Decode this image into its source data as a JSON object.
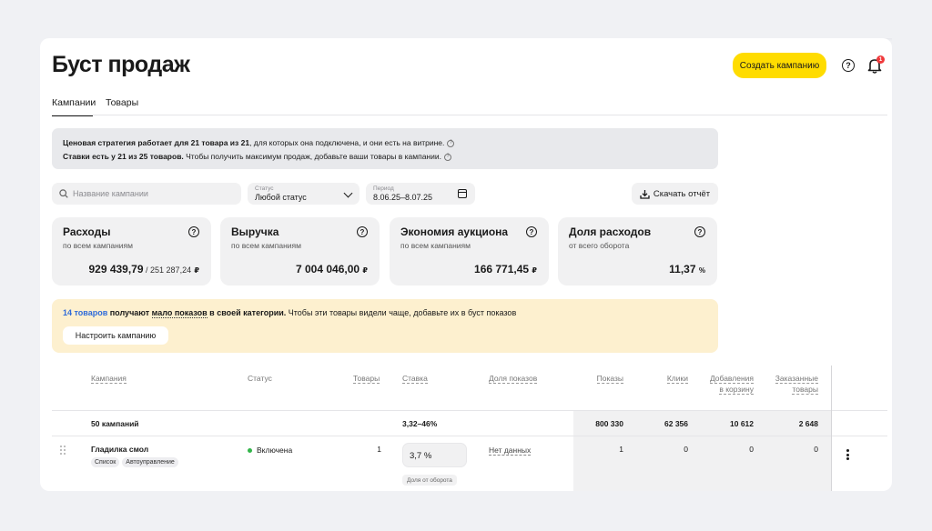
{
  "page": {
    "title": "Буст продаж",
    "create_button": "Создать кампанию",
    "notifications_count": "1"
  },
  "tabs": [
    {
      "label": "Кампании",
      "active": true
    },
    {
      "label": "Товары",
      "active": false
    }
  ],
  "info": {
    "line1_bold": "Ценовая стратегия работает для 21 товара из 21",
    "line1_rest": ", для которых она подключена, и они есть на витрине.",
    "line2_bold": "Ставки есть у 21 из 25 товаров.",
    "line2_rest": " Чтобы получить максимум продаж, добавьте ваши товары в кампании."
  },
  "filters": {
    "search_placeholder": "Название кампании",
    "status_label": "Статус",
    "status_value": "Любой статус",
    "period_label": "Период",
    "period_value": "8.06.25–8.07.25",
    "download_label": "Скачать отчёт"
  },
  "metrics": [
    {
      "title": "Расходы",
      "subtitle": "по всем кампаниям",
      "value": "929 439,79",
      "value_sub": " / 251 287,24",
      "currency": "₽"
    },
    {
      "title": "Выручка",
      "subtitle": "по всем кампаниям",
      "value": "7 004 046,00",
      "value_sub": "",
      "currency": "₽"
    },
    {
      "title": "Экономия аукциона",
      "subtitle": "по всем кампаниям",
      "value": "166 771,45",
      "value_sub": "",
      "currency": "₽"
    },
    {
      "title": "Доля расходов",
      "subtitle": "от всего оборота",
      "value": "11,37",
      "value_sub": "",
      "currency": "%"
    }
  ],
  "banner": {
    "link": "14 товаров",
    "text1": " получают ",
    "dotted": "мало показов",
    "text2": " в своей категории.",
    "text3": " Чтобы эти товары видели чаще, добавьте их в буст показов",
    "button": "Настроить кампанию"
  },
  "table": {
    "headers": {
      "campaign": "Кампания",
      "status": "Статус",
      "goods": "Товары",
      "rate": "Ставка",
      "share": "Доля показов",
      "views": "Показы",
      "clicks": "Клики",
      "cart_1": "Добавления",
      "cart_2": "в корзину",
      "ordered_1": "Заказанные",
      "ordered_2": "товары"
    },
    "summary": {
      "campaigns": "50 кампаний",
      "rate": "3,32–46%",
      "views": "800 330",
      "clicks": "62 356",
      "cart": "10 612",
      "ordered": "2 648"
    },
    "rows": [
      {
        "name": "Гладилка смол",
        "tags": [
          "Список",
          "Автоуправление"
        ],
        "status": "Включена",
        "goods": "1",
        "rate": "3,7 %",
        "rate_hint": "Доля от оборота",
        "share": "Нет данных",
        "views": "1",
        "clicks": "0",
        "cart": "0",
        "ordered": "0"
      }
    ]
  }
}
